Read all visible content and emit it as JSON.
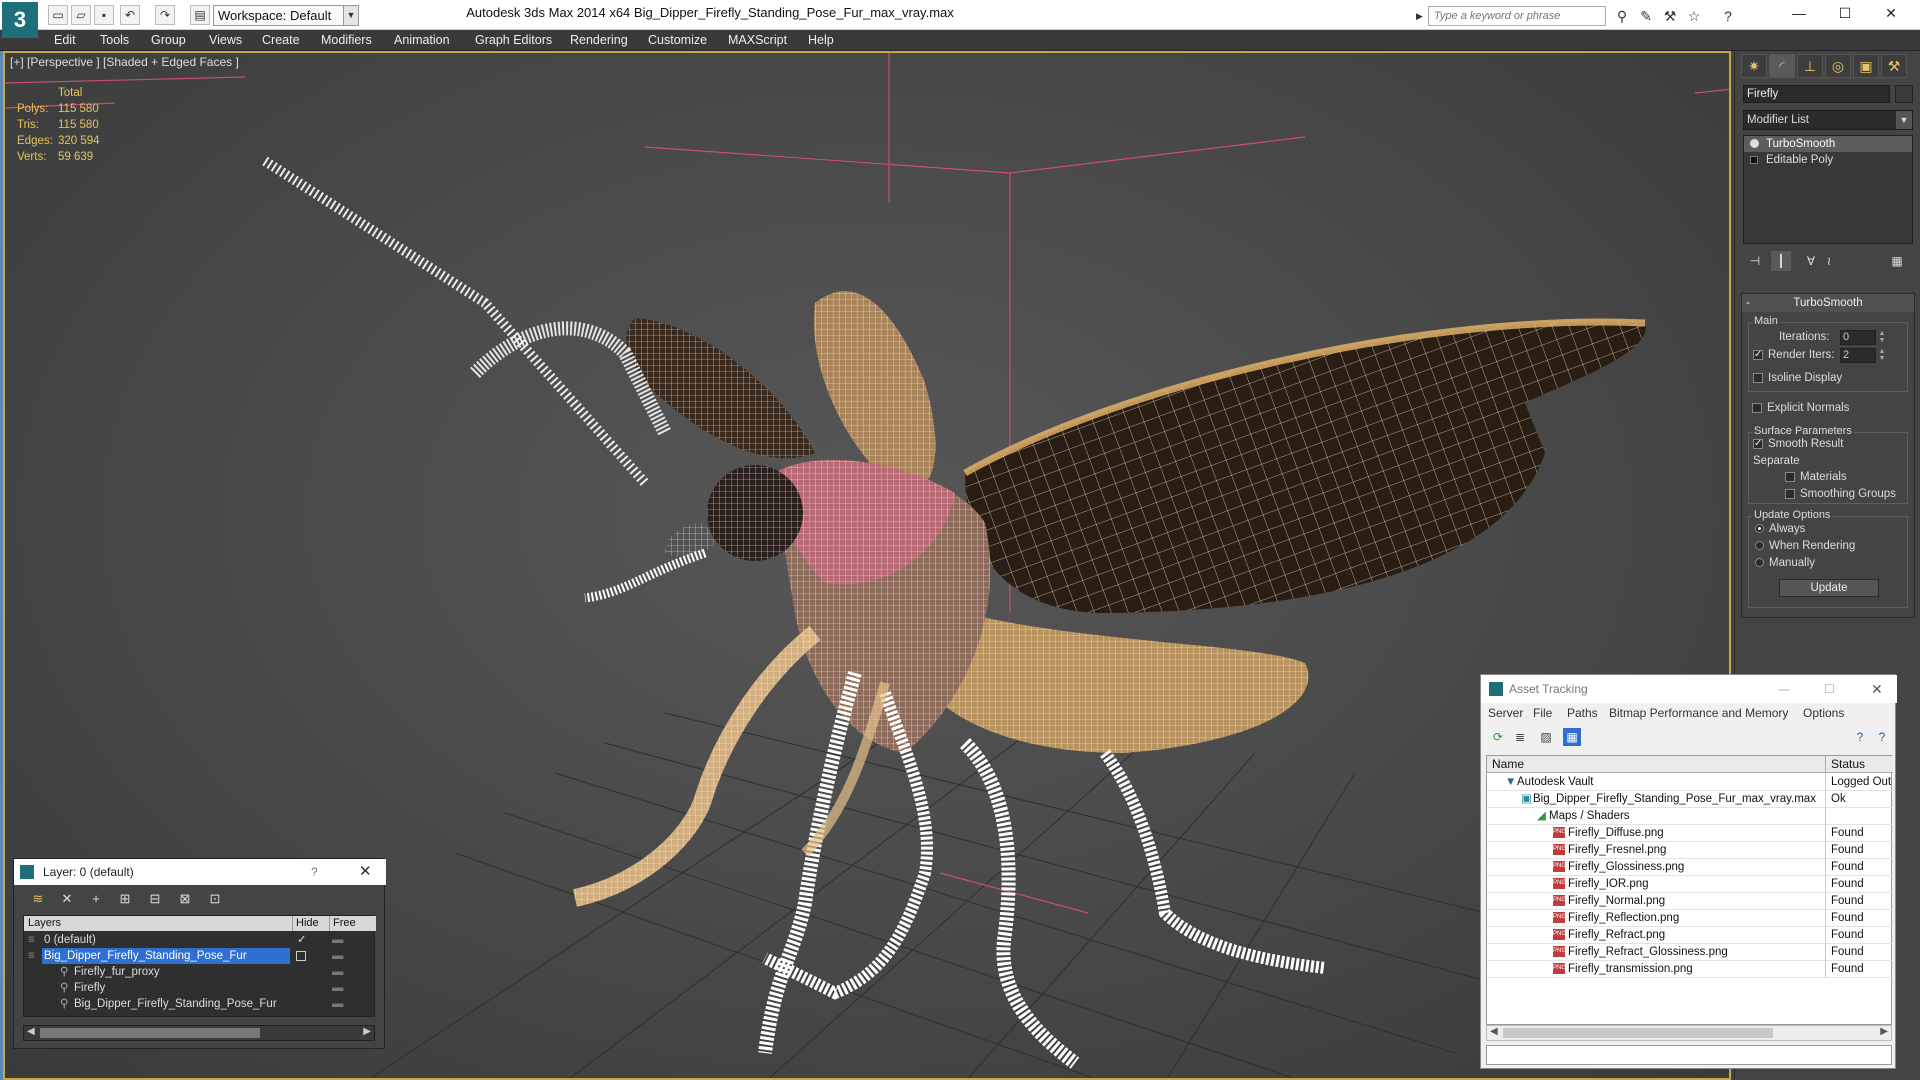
{
  "window": {
    "title": "Autodesk 3ds Max  2014 x64      Big_Dipper_Firefly_Standing_Pose_Fur_max_vray.max",
    "app_icon": "3ds-max-logo",
    "workspace": "Workspace: Default",
    "search_placeholder": "Type a keyword or phrase",
    "minimize": "—",
    "maximize": "☐",
    "close": "✕"
  },
  "menu": [
    "Edit",
    "Tools",
    "Group",
    "Views",
    "Create",
    "Modifiers",
    "Animation",
    "Graph Editors",
    "Rendering",
    "Customize",
    "MAXScript",
    "Help"
  ],
  "viewport": {
    "label": "[+] [Perspective ] [Shaded + Edged Faces ]",
    "stats": {
      "header": "Total",
      "rows": [
        {
          "key": "Polys:",
          "value": "115 580"
        },
        {
          "key": "Tris:",
          "value": "115 580"
        },
        {
          "key": "Edges:",
          "value": "320 594"
        },
        {
          "key": "Verts:",
          "value": "59 639"
        }
      ]
    }
  },
  "command_panel": {
    "object_name": "Firefly",
    "modifier_list": "Modifier List",
    "stack": [
      "TurboSmooth",
      "Editable Poly"
    ],
    "rollout": {
      "title": "TurboSmooth",
      "main_group": "Main",
      "iterations_label": "Iterations:",
      "iterations_value": "0",
      "render_iters_label": "Render Iters:",
      "render_iters_value": "2",
      "isoline": "Isoline Display",
      "explicit_normals": "Explicit Normals",
      "surface_group": "Surface Parameters",
      "smooth_result": "Smooth Result",
      "separate": "Separate",
      "materials": "Materials",
      "smoothing_groups": "Smoothing Groups",
      "update_group": "Update Options",
      "always": "Always",
      "when_rendering": "When Rendering",
      "manually": "Manually",
      "update_button": "Update"
    }
  },
  "layer_window": {
    "title": "Layer: 0 (default)",
    "help": "?",
    "close": "✕",
    "columns": [
      "Layers",
      "Hide",
      "Free"
    ],
    "rows": [
      {
        "name": "0 (default)",
        "indent": 0
      },
      {
        "name": "Big_Dipper_Firefly_Standing_Pose_Fur",
        "indent": 0
      },
      {
        "name": "Firefly_fur_proxy",
        "indent": 1
      },
      {
        "name": "Firefly",
        "indent": 1
      },
      {
        "name": "Big_Dipper_Firefly_Standing_Pose_Fur",
        "indent": 1
      }
    ]
  },
  "asset_window": {
    "title": "Asset Tracking",
    "menu": [
      "Server",
      "File",
      "Paths",
      "Bitmap Performance and Memory",
      "Options"
    ],
    "columns": [
      "Name",
      "Status"
    ],
    "rows": [
      {
        "name": "Autodesk Vault",
        "status": "Logged Out",
        "indent": 0
      },
      {
        "name": "Big_Dipper_Firefly_Standing_Pose_Fur_max_vray.max",
        "status": "Ok",
        "indent": 1
      },
      {
        "name": "Maps / Shaders",
        "status": "",
        "indent": 2
      },
      {
        "name": "Firefly_Diffuse.png",
        "status": "Found",
        "indent": 3
      },
      {
        "name": "Firefly_Fresnel.png",
        "status": "Found",
        "indent": 3
      },
      {
        "name": "Firefly_Glossiness.png",
        "status": "Found",
        "indent": 3
      },
      {
        "name": "Firefly_IOR.png",
        "status": "Found",
        "indent": 3
      },
      {
        "name": "Firefly_Normal.png",
        "status": "Found",
        "indent": 3
      },
      {
        "name": "Firefly_Reflection.png",
        "status": "Found",
        "indent": 3
      },
      {
        "name": "Firefly_Refract.png",
        "status": "Found",
        "indent": 3
      },
      {
        "name": "Firefly_Refract_Glossiness.png",
        "status": "Found",
        "indent": 3
      },
      {
        "name": "Firefly_transmission.png",
        "status": "Found",
        "indent": 3
      }
    ]
  }
}
